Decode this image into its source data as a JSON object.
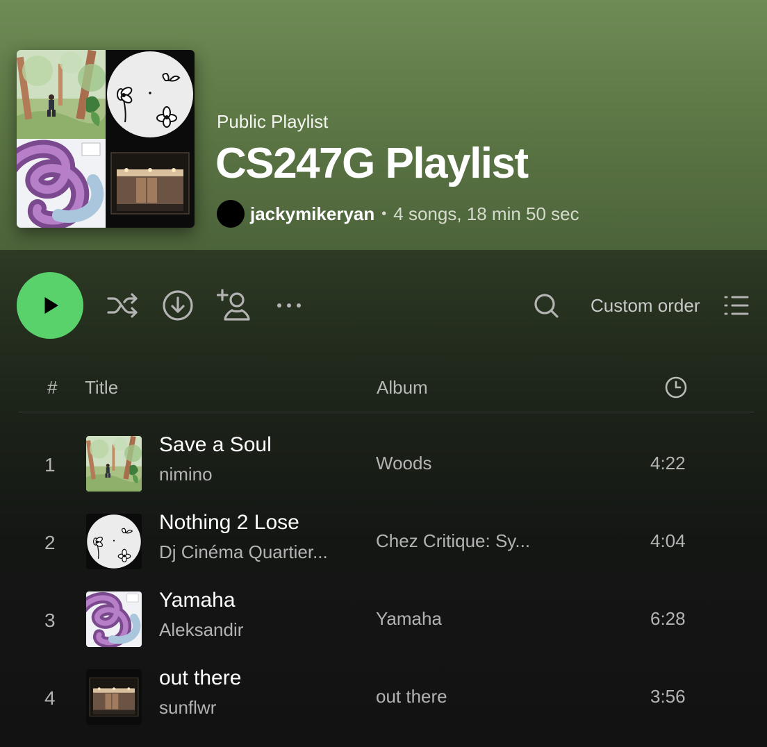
{
  "playlist": {
    "type_label": "Public Playlist",
    "title": "CS247G Playlist",
    "owner": "jackymikeryan",
    "separator": "•",
    "stats": "4 songs, 18 min 50 sec"
  },
  "controls": {
    "order_label": "Custom order",
    "icons": [
      "play-icon",
      "shuffle-icon",
      "download-icon",
      "add-user-icon",
      "more-icon",
      "search-icon",
      "list-icon"
    ]
  },
  "columns": {
    "number": "#",
    "title": "Title",
    "album": "Album",
    "duration_icon": "clock-icon"
  },
  "tracks": [
    {
      "number": "1",
      "title": "Save a Soul",
      "artist": "nimino",
      "album": "Woods",
      "duration": "4:22"
    },
    {
      "number": "2",
      "title": "Nothing 2 Lose",
      "artist": "Dj Cinéma Quartier...",
      "album": "Chez Critique: Sy...",
      "duration": "4:04"
    },
    {
      "number": "3",
      "title": "Yamaha",
      "artist": "Aleksandir",
      "album": "Yamaha",
      "duration": "6:28"
    },
    {
      "number": "4",
      "title": "out there",
      "artist": "sunflwr",
      "album": "out there",
      "duration": "3:56"
    }
  ],
  "colors": {
    "accent": "#5ad26c",
    "header": "#6f8b55",
    "background": "#121212",
    "secondary_text": "#b3b3b3"
  },
  "cover_logo_text": "nimino"
}
